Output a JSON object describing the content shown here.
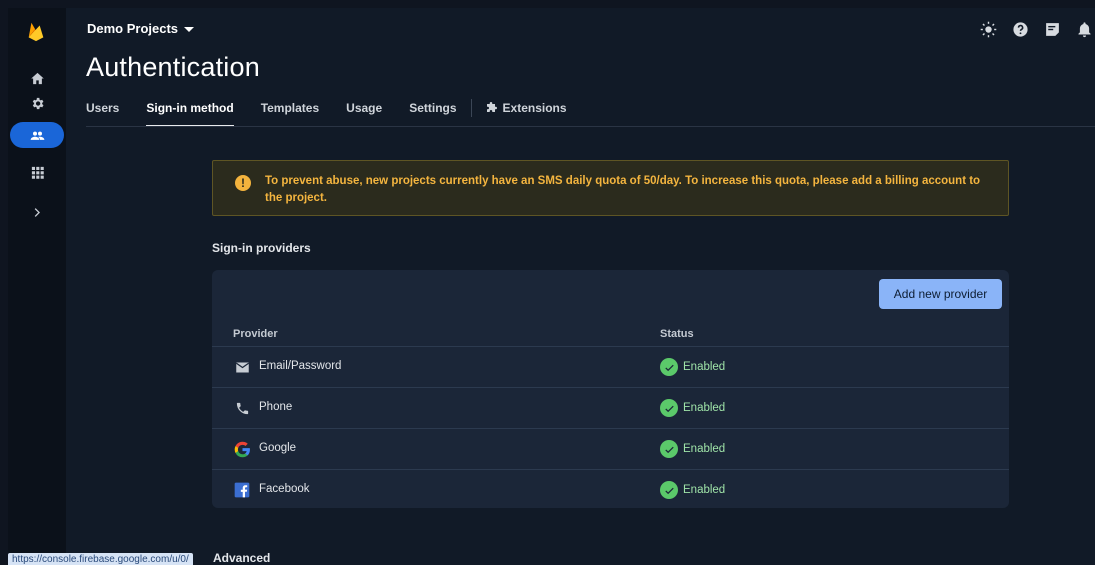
{
  "topbar": {
    "project_name": "Demo Projects",
    "icons": [
      "theme-icon",
      "help-icon",
      "feedback-icon",
      "notifications-icon"
    ]
  },
  "rail": {
    "items": [
      "home-icon",
      "settings-icon",
      "users-icon",
      "apps-icon",
      "expand-icon"
    ],
    "active": "users-icon"
  },
  "page": {
    "title": "Authentication"
  },
  "tabs": [
    {
      "label": "Users"
    },
    {
      "label": "Sign-in method",
      "active": true
    },
    {
      "label": "Templates"
    },
    {
      "label": "Usage"
    },
    {
      "label": "Settings"
    },
    {
      "label": "Extensions"
    }
  ],
  "banner": {
    "text": "To prevent abuse, new projects currently have an SMS daily quota of 50/day. To increase this quota, please add a billing account to the project.",
    "color": "#f4b53f"
  },
  "providers": {
    "section_label": "Sign-in providers",
    "add_button": "Add new provider",
    "columns": {
      "provider": "Provider",
      "status": "Status"
    },
    "rows": [
      {
        "icon": "email-icon",
        "name": "Email/Password",
        "status": "Enabled"
      },
      {
        "icon": "phone-icon",
        "name": "Phone",
        "status": "Enabled"
      },
      {
        "icon": "google-icon",
        "name": "Google",
        "status": "Enabled"
      },
      {
        "icon": "facebook-icon",
        "name": "Facebook",
        "status": "Enabled"
      }
    ]
  },
  "statusbar": {
    "url": "https://console.firebase.google.com/u/0/"
  },
  "advanced": {
    "label": "Advanced"
  },
  "colors": {
    "accent": "#1a66d8",
    "button": "#8ab4f8",
    "enabled": "#5bc96a",
    "warning": "#f3b33d"
  }
}
